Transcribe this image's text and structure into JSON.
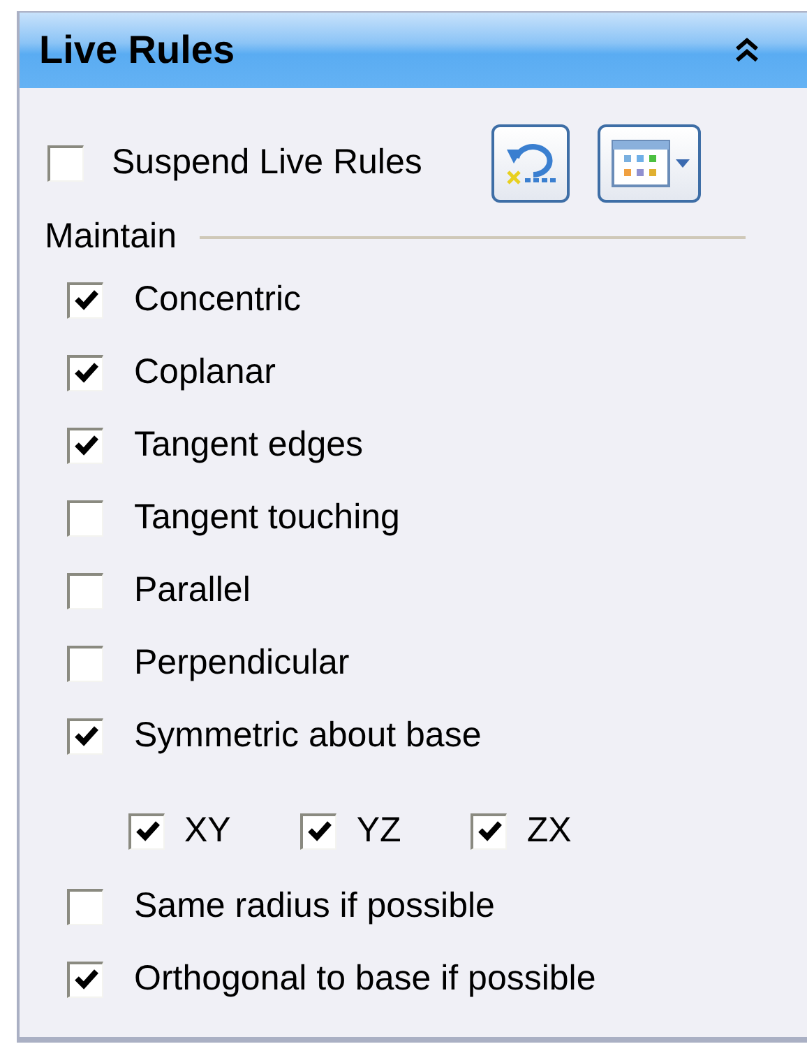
{
  "panel": {
    "title": "Live Rules"
  },
  "suspend": {
    "label": "Suspend Live Rules",
    "checked": false
  },
  "group": {
    "label": "Maintain"
  },
  "rules": [
    {
      "label": "Concentric",
      "checked": true
    },
    {
      "label": "Coplanar",
      "checked": true
    },
    {
      "label": "Tangent edges",
      "checked": true
    },
    {
      "label": "Tangent touching",
      "checked": false
    },
    {
      "label": "Parallel",
      "checked": false
    },
    {
      "label": "Perpendicular",
      "checked": false
    },
    {
      "label": "Symmetric about base",
      "checked": true,
      "children": [
        {
          "label": "XY",
          "checked": true
        },
        {
          "label": "YZ",
          "checked": true
        },
        {
          "label": "ZX",
          "checked": true
        }
      ]
    },
    {
      "label": "Same radius if possible",
      "checked": false
    },
    {
      "label": "Orthogonal to base if possible",
      "checked": true
    }
  ]
}
